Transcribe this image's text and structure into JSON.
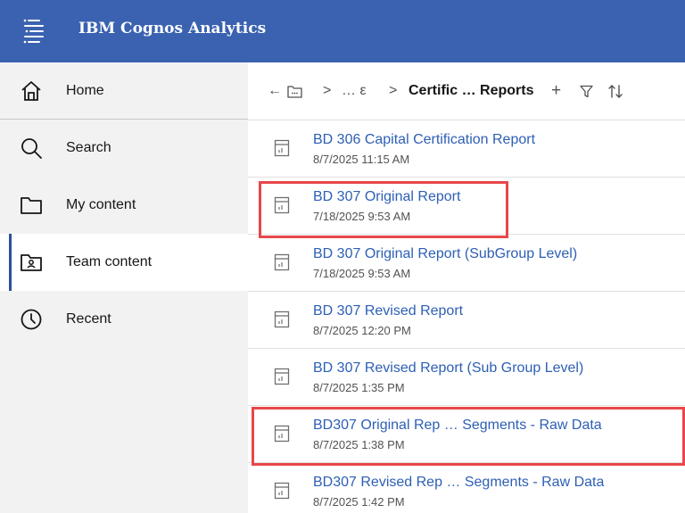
{
  "app": {
    "title": "IBM Cognos Analytics"
  },
  "colors": {
    "header": "#3a62b1",
    "link": "#2d5fb5",
    "highlight": "#e8474a",
    "sidebar": "#f2f2f2"
  },
  "sidebar": {
    "items": [
      {
        "label": "Home",
        "icon": "home-icon"
      },
      {
        "label": "Search",
        "icon": "search-icon"
      },
      {
        "label": "My content",
        "icon": "folder-icon"
      },
      {
        "label": "Team content",
        "icon": "team-folder-icon",
        "active": true
      },
      {
        "label": "Recent",
        "icon": "clock-icon"
      }
    ]
  },
  "breadcrumb": {
    "back": "←",
    "sep1": ">",
    "ellipsis": "… ε",
    "sep2": ">",
    "current": "Certific … Reports",
    "add": "+"
  },
  "reports": [
    {
      "name": "BD 306 Capital Certification Report",
      "date": "8/7/2025 11:15 AM"
    },
    {
      "name": "BD 307 Original Report",
      "date": "7/18/2025 9:53 AM",
      "highlighted": true
    },
    {
      "name": "BD 307 Original Report (SubGroup Level)",
      "date": "7/18/2025 9:53 AM"
    },
    {
      "name": "BD 307 Revised Report",
      "date": "8/7/2025 12:20 PM"
    },
    {
      "name": "BD 307 Revised Report (Sub Group Level)",
      "date": "8/7/2025 1:35 PM"
    },
    {
      "name": "BD307 Original Rep … Segments - Raw Data",
      "date": "8/7/2025 1:38 PM",
      "highlighted": true
    },
    {
      "name": "BD307 Revised Rep … Segments - Raw Data",
      "date": "8/7/2025 1:42 PM"
    }
  ]
}
